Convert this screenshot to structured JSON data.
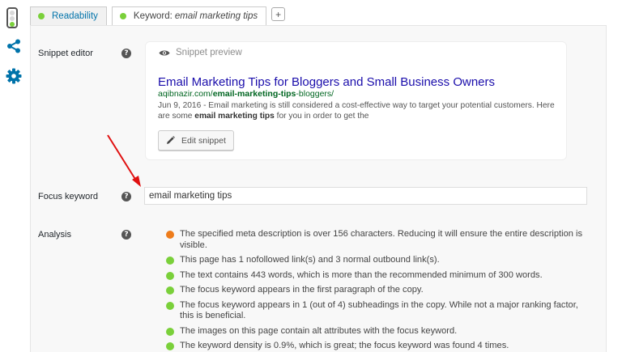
{
  "colors": {
    "good": "#7ad03a",
    "ok": "#ee7c1b",
    "link": "#1a0dab",
    "url": "#006621",
    "tab_link": "#0073aa",
    "arrow": "#e01010"
  },
  "tabs": [
    {
      "label": "Readability",
      "status": "good"
    },
    {
      "label": "Keyword:",
      "keyword": "email marketing tips",
      "status": "good"
    }
  ],
  "add_tab_label": "+",
  "snippet": {
    "label": "Snippet editor",
    "header": "Snippet preview",
    "title": "Email Marketing Tips for Bloggers and Small Business Owners",
    "url_prefix": "aqibnazir.com/",
    "url_bold": "email-marketing-tips",
    "url_suffix": "-bloggers/",
    "date": "Jun 9, 2016",
    "desc_part1": " - Email marketing is still considered a cost-effective way to target your potential customers. Here are some ",
    "desc_bold": "email marketing tips",
    "desc_part2": " for you in order to get the",
    "edit_button": "Edit snippet"
  },
  "focus": {
    "label": "Focus keyword",
    "value": "email marketing tips"
  },
  "analysis": {
    "label": "Analysis",
    "items": [
      {
        "status": "ok",
        "text": "The specified meta description is over 156 characters. Reducing it will ensure the entire description is visible."
      },
      {
        "status": "good",
        "text": "This page has 1 nofollowed link(s) and 3 normal outbound link(s)."
      },
      {
        "status": "good",
        "text": "The text contains 443 words, which is more than the recommended minimum of 300 words."
      },
      {
        "status": "good",
        "text": "The focus keyword appears in the first paragraph of the copy."
      },
      {
        "status": "good",
        "text": "The focus keyword appears in 1 (out of 4) subheadings in the copy. While not a major ranking factor, this is beneficial."
      },
      {
        "status": "good",
        "text": "The images on this page contain alt attributes with the focus keyword."
      },
      {
        "status": "good",
        "text": "The keyword density is 0.9%, which is great; the focus keyword was found 4 times."
      }
    ]
  },
  "help_glyph": "?"
}
